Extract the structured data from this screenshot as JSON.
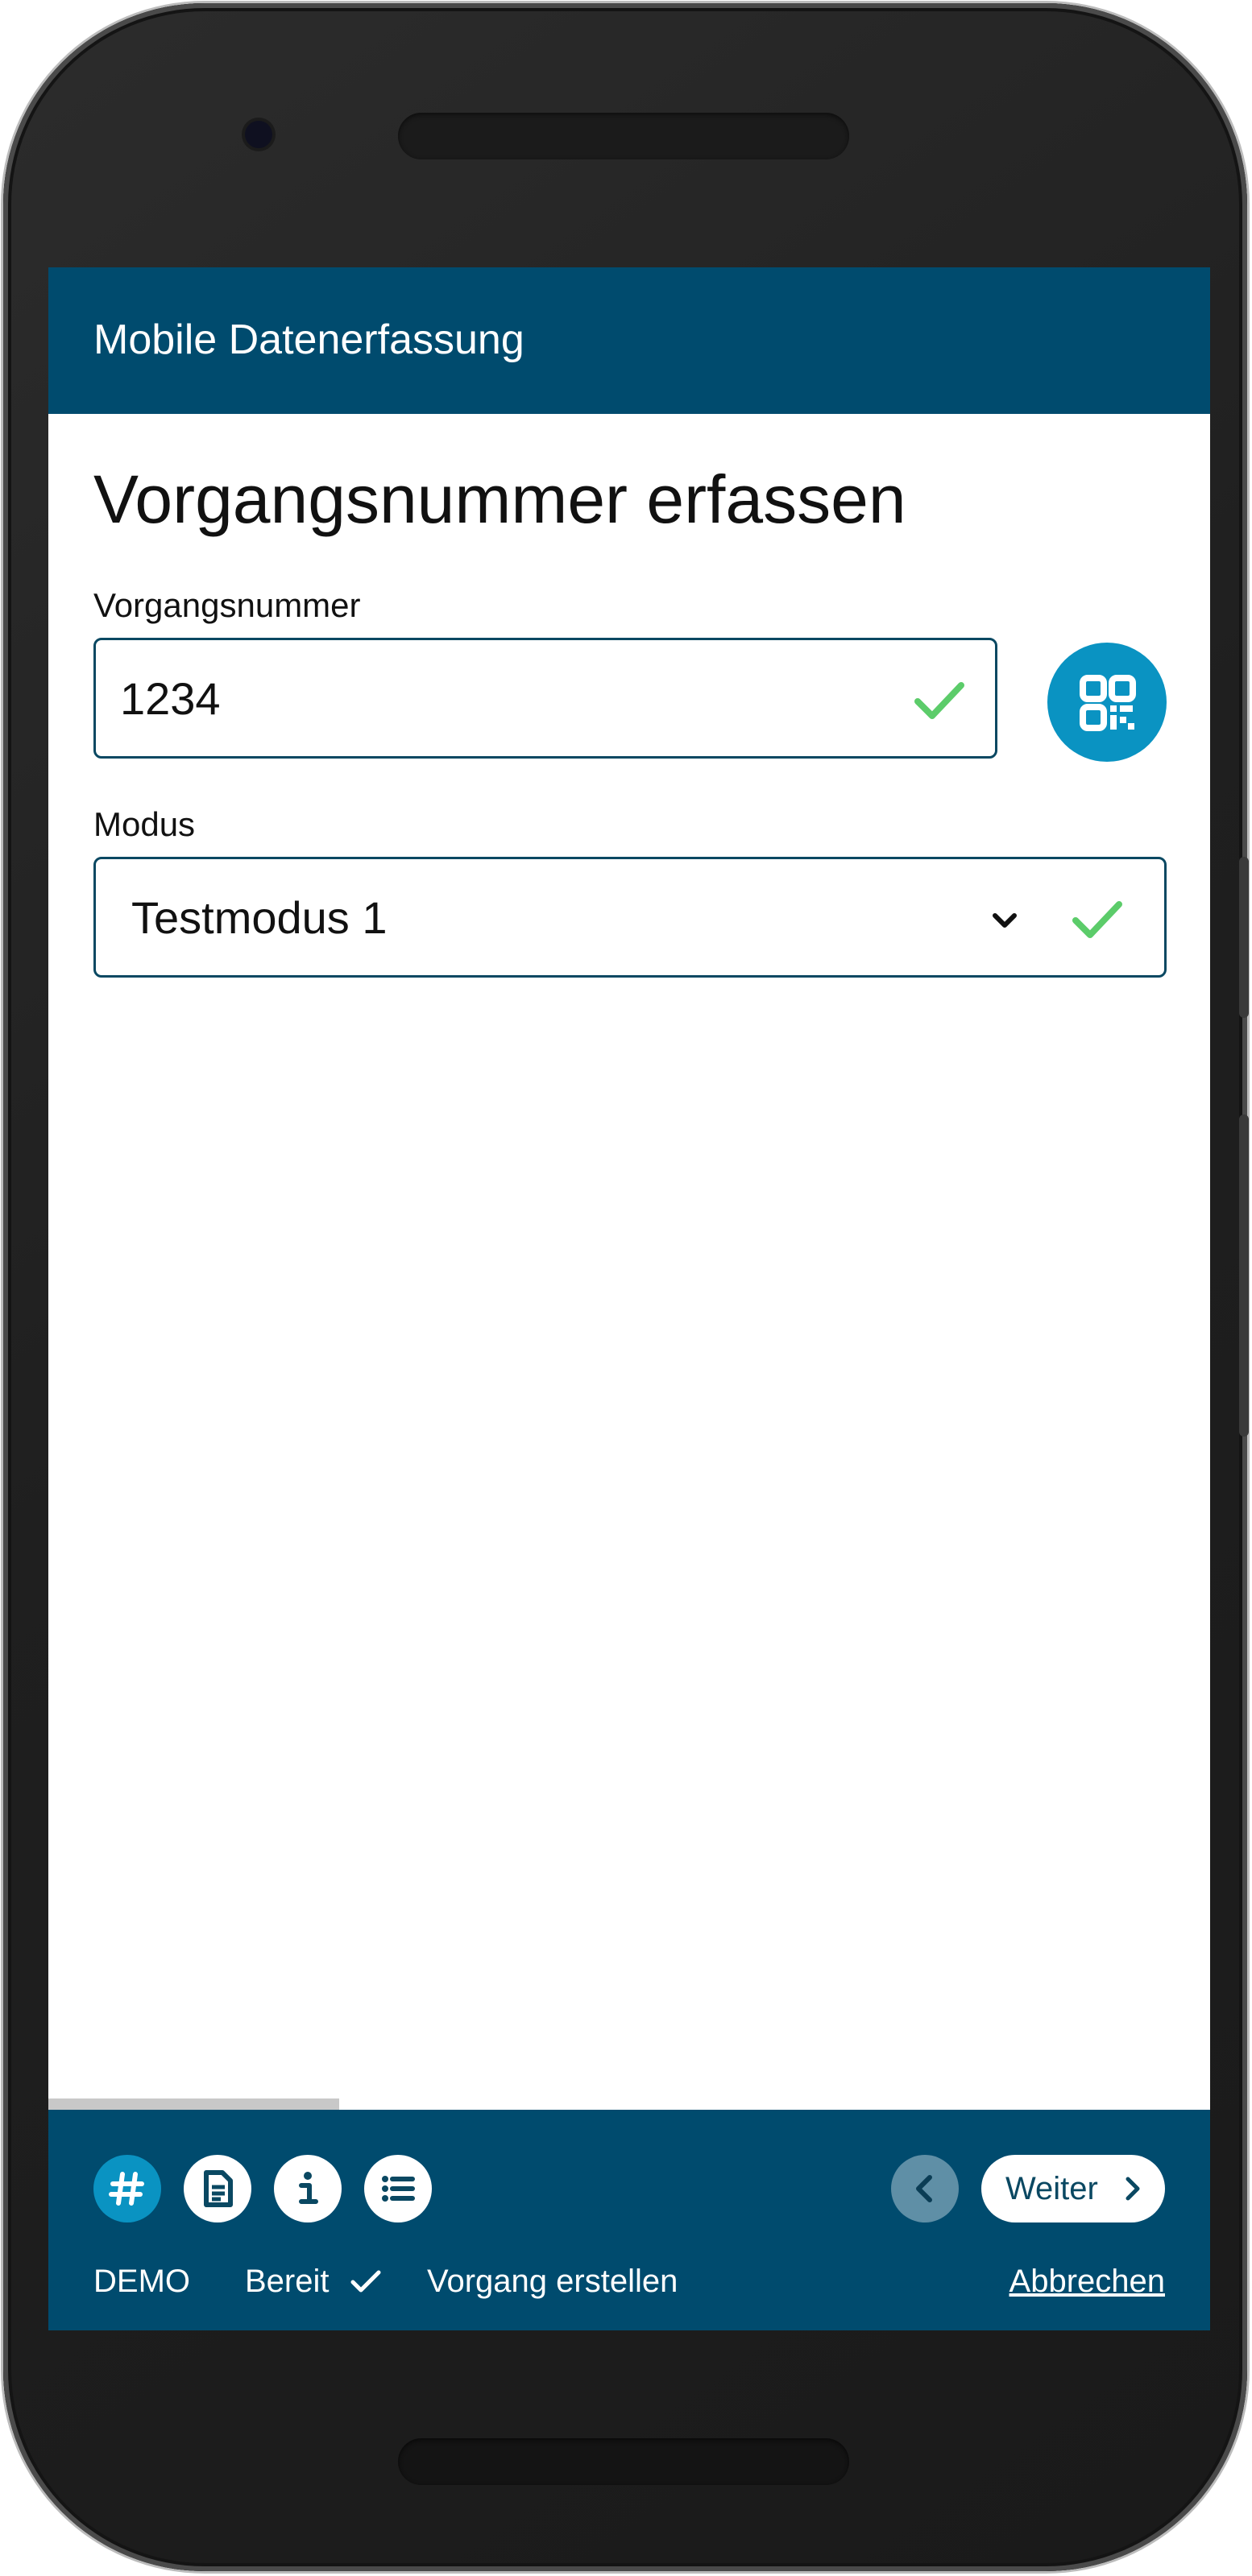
{
  "app": {
    "title": "Mobile Datenerfassung"
  },
  "page": {
    "title": "Vorgangsnummer erfassen"
  },
  "form": {
    "number_label": "Vorgangsnummer",
    "number_value": "1234",
    "mode_label": "Modus",
    "mode_value": "Testmodus 1"
  },
  "progress": {
    "fraction": 0.25
  },
  "footer": {
    "next_label": "Weiter",
    "mode_badge": "DEMO",
    "status": "Bereit",
    "step": "Vorgang erstellen",
    "cancel_label": "Abbrechen"
  },
  "colors": {
    "primary": "#004b6e",
    "accent": "#0a93c2",
    "valid": "#5ccc6a",
    "disabled": "#5f8fa6"
  },
  "icons": {
    "scan": "qr-code-icon",
    "nav": [
      "hash-icon",
      "document-icon",
      "info-icon",
      "list-icon"
    ]
  }
}
